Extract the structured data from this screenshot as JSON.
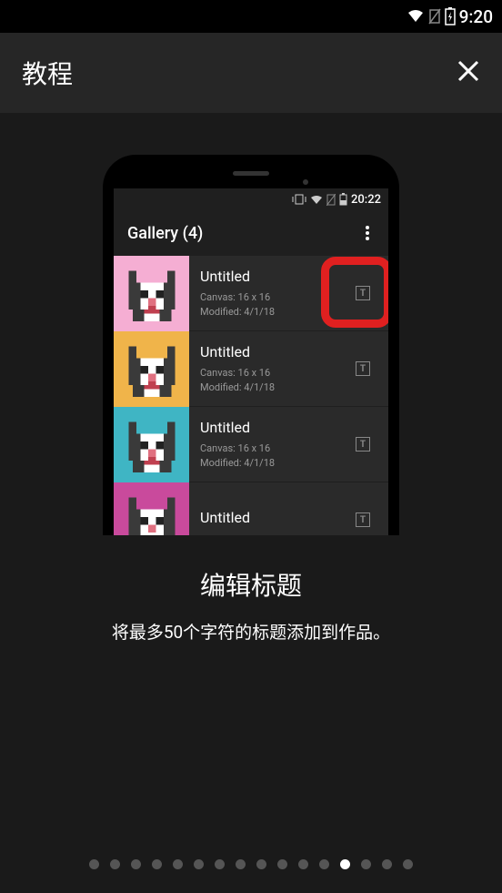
{
  "status_bar": {
    "time": "9:20"
  },
  "header": {
    "title": "教程"
  },
  "phone": {
    "inner_status_time": "20:22",
    "gallery_title": "Gallery (4)",
    "items": [
      {
        "name": "Untitled",
        "canvas": "Canvas: 16 x 16",
        "modified": "Modified: 4/1/18"
      },
      {
        "name": "Untitled",
        "canvas": "Canvas: 16 x 16",
        "modified": "Modified: 4/1/18"
      },
      {
        "name": "Untitled",
        "canvas": "Canvas: 16 x 16",
        "modified": "Modified: 4/1/18"
      },
      {
        "name": "Untitled",
        "canvas": "",
        "modified": ""
      }
    ]
  },
  "tutorial": {
    "title": "编辑标题",
    "description": "将最多50个字符的标题添加到作品。"
  },
  "pagination": {
    "total": 16,
    "active_index": 12
  }
}
